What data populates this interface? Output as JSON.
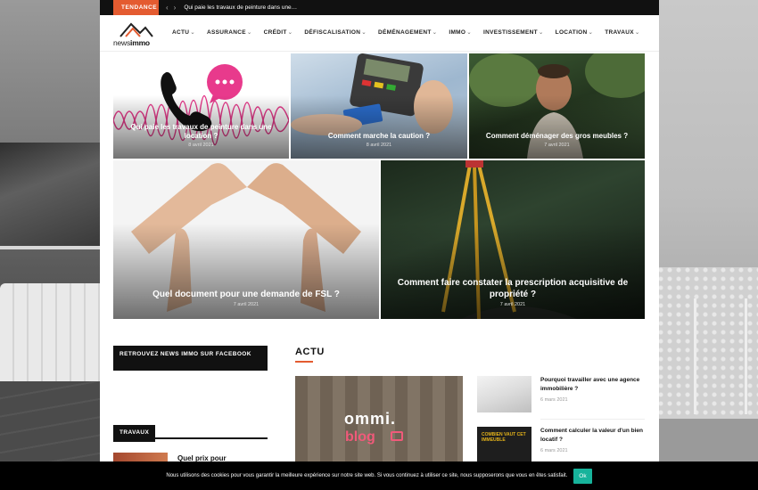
{
  "topbar": {
    "trending_label": "TENDANCE",
    "ticker": "Qui paie les travaux de peinture dans une…"
  },
  "logo": {
    "text_light": "news",
    "text_bold": "immo"
  },
  "nav": {
    "items": [
      {
        "label": "ACTU"
      },
      {
        "label": "ASSURANCE"
      },
      {
        "label": "CRÉDIT"
      },
      {
        "label": "DÉFISCALISATION"
      },
      {
        "label": "DÉMÉNAGEMENT"
      },
      {
        "label": "IMMO"
      },
      {
        "label": "INVESTISSEMENT"
      },
      {
        "label": "LOCATION"
      },
      {
        "label": "TRAVAUX"
      }
    ]
  },
  "hero": [
    {
      "title": "Qui paie les travaux de peinture dans une location ?",
      "date": "8 avril 2021"
    },
    {
      "title": "Comment marche la caution ?",
      "date": "8 avril 2021"
    },
    {
      "title": "Comment déménager des gros meubles ?",
      "date": "7 avril 2021"
    },
    {
      "title": "Quel document pour une demande de FSL ?",
      "date": "7 avril 2021"
    },
    {
      "title": "Comment faire constater la prescription acquisitive de propriété ?",
      "date": "7 avril 2021"
    }
  ],
  "facebook_box": {
    "title": "RETROUVEZ NEWS IMMO SUR FACEBOOK"
  },
  "travaux": {
    "heading": "TRAVAUX",
    "item_title": "Quel prix pour"
  },
  "actu": {
    "heading": "ACTU",
    "featured": {
      "text1": "ommi.",
      "text2": "blog"
    },
    "side": [
      {
        "title": "Pourquoi travailler avec une agence immobilière ?",
        "date": "6 mars 2021"
      },
      {
        "title": "Comment calculer la valeur d'un bien locatif ?",
        "date": "6 mars 2021",
        "thumb_text": "COMBIEN VAUT CET IMMEUBLE"
      }
    ]
  },
  "cookie": {
    "text": "Nous utilisons des cookies pour vous garantir la meilleure expérience sur notre site web. Si vous continuez à utiliser ce site, nous supposerons que vous en êtes satisfait.",
    "ok_label": "Ok"
  },
  "colors": {
    "accent": "#e45b30",
    "ok": "#17b39b",
    "pink": "#e83a8c"
  }
}
